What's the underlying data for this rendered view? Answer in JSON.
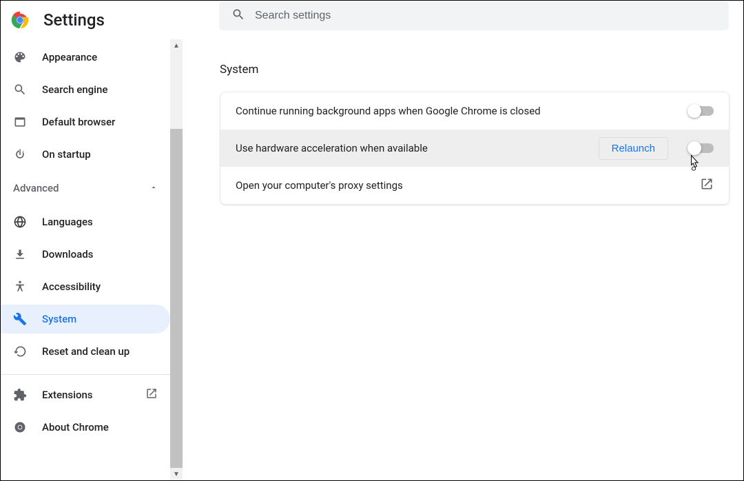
{
  "app": {
    "title": "Settings"
  },
  "search": {
    "placeholder": "Search settings"
  },
  "sidebar": {
    "items": [
      {
        "id": "appearance",
        "label": "Appearance"
      },
      {
        "id": "search-engine",
        "label": "Search engine"
      },
      {
        "id": "default-browser",
        "label": "Default browser"
      },
      {
        "id": "on-startup",
        "label": "On startup"
      }
    ],
    "advanced_label": "Advanced",
    "advanced_items": [
      {
        "id": "languages",
        "label": "Languages"
      },
      {
        "id": "downloads",
        "label": "Downloads"
      },
      {
        "id": "accessibility",
        "label": "Accessibility"
      },
      {
        "id": "system",
        "label": "System",
        "active": true
      },
      {
        "id": "reset",
        "label": "Reset and clean up"
      }
    ],
    "footer_items": [
      {
        "id": "extensions",
        "label": "Extensions",
        "external": true
      },
      {
        "id": "about",
        "label": "About Chrome"
      }
    ]
  },
  "main": {
    "section_title": "System",
    "rows": {
      "bg_apps": {
        "label": "Continue running background apps when Google Chrome is closed",
        "toggle": false
      },
      "hw_accel": {
        "label": "Use hardware acceleration when available",
        "relaunch_label": "Relaunch",
        "toggle": false,
        "highlighted": true
      },
      "proxy": {
        "label": "Open your computer's proxy settings"
      }
    }
  }
}
